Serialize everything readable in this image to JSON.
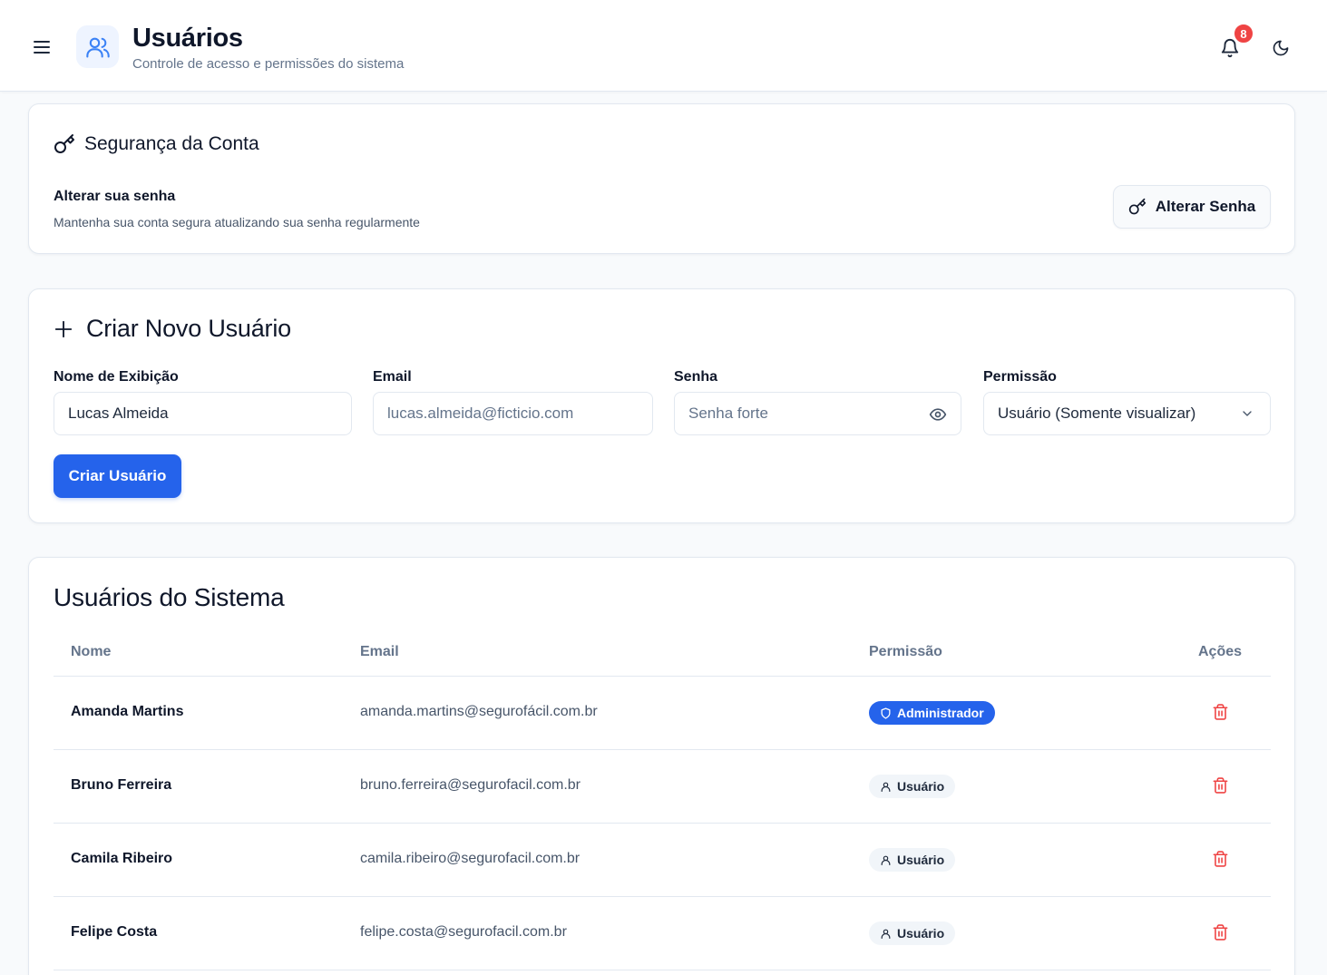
{
  "header": {
    "title": "Usuários",
    "subtitle": "Controle de acesso e permissões do sistema",
    "notification_count": "8"
  },
  "security": {
    "title": "Segurança da Conta",
    "label": "Alterar sua senha",
    "description": "Mantenha sua conta segura atualizando sua senha regularmente",
    "button_label": "Alterar Senha"
  },
  "create_user": {
    "title": "Criar Novo Usuário",
    "name_label": "Nome de Exibição",
    "name_value": "Lucas Almeida",
    "email_label": "Email",
    "email_placeholder": "lucas.almeida@ficticio.com",
    "password_label": "Senha",
    "password_placeholder": "Senha forte",
    "permission_label": "Permissão",
    "permission_value": "Usuário (Somente visualizar)",
    "submit_label": "Criar Usuário"
  },
  "users_table": {
    "title": "Usuários do Sistema",
    "columns": [
      "Nome",
      "Email",
      "Permissão",
      "Ações"
    ],
    "rows": [
      {
        "name": "Amanda Martins",
        "email": "amanda.martins@segurofácil.com.br",
        "role": "Administrador",
        "role_type": "admin"
      },
      {
        "name": "Bruno Ferreira",
        "email": "bruno.ferreira@segurofacil.com.br",
        "role": "Usuário",
        "role_type": "user"
      },
      {
        "name": "Camila Ribeiro",
        "email": "camila.ribeiro@segurofacil.com.br",
        "role": "Usuário",
        "role_type": "user"
      },
      {
        "name": "Felipe Costa",
        "email": "felipe.costa@segurofacil.com.br",
        "role": "Usuário",
        "role_type": "user"
      }
    ]
  },
  "icons": {
    "menu": "menu-icon",
    "app": "users-icon",
    "notifications": "bell-icon",
    "theme": "moon-icon",
    "key": "key-icon",
    "plus": "plus-icon",
    "eye": "eye-icon",
    "chevron": "chevron-down-icon",
    "admin_badge": "shield-icon",
    "user_badge": "user-icon",
    "delete": "trash-icon"
  },
  "colors": {
    "primary": "#2563eb",
    "danger": "#ef4444",
    "background": "#f8fafc",
    "text": "#0f172a",
    "muted": "#64748b"
  }
}
